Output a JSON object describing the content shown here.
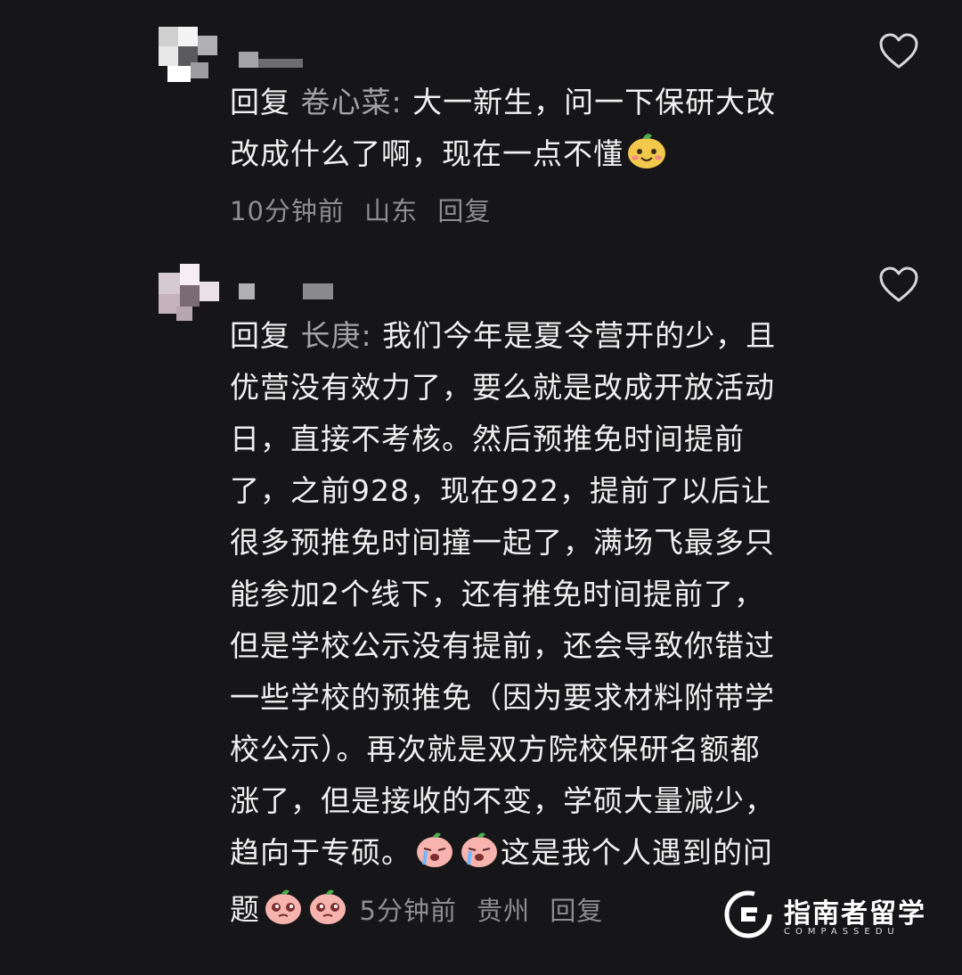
{
  "comments": [
    {
      "reply_prefix": "回复",
      "mention": "卷心菜:",
      "lines": [
        "大一新生，问一下保研大改",
        "改成什么了啊，现在一点不懂"
      ],
      "emoji": "smiling-face-emoji",
      "time": "10分钟前",
      "location": "山东",
      "reply_label": "回复"
    },
    {
      "reply_prefix": "回复",
      "mention": "长庚:",
      "lines": [
        "我们今年是夏令营开的少，且",
        "优营没有效力了，要么就是改成开放活动",
        "日，直接不考核。然后预推免时间提前",
        "了，之前928，现在922，提前了以后让",
        "很多预推免时间撞一起了，满场飞最多只",
        "能参加2个线下，还有推免时间提前了，",
        "但是学校公示没有提前，还会导致你错过",
        "一些学校的预推免（因为要求材料附带学",
        "校公示）。再次就是双方院校保研名额都",
        "涨了，但是接收的不变，学硕大量减少，",
        "趋向于专硕。",
        "这是我个人遇到的问",
        "题"
      ],
      "emoji": "crying-peach-emoji",
      "time": "5分钟前",
      "location": "贵州",
      "reply_label": "回复"
    }
  ],
  "watermark": {
    "brand": "指南者留学",
    "sub": "COMPASSEDU"
  },
  "colors": {
    "background": "#161618",
    "text": "#f0f0f0",
    "muted": "#8e8e92"
  }
}
